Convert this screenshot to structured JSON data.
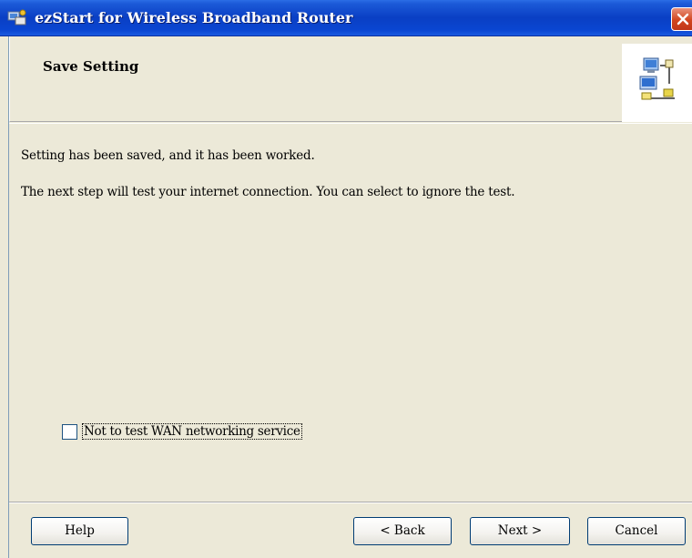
{
  "window": {
    "title": "ezStart for Wireless Broadband Router"
  },
  "header": {
    "title": "Save Setting",
    "logo_icon": "network-computers-icon"
  },
  "content": {
    "line1": "Setting has been saved, and it has been worked.",
    "line2": "The next step will test your internet connection. You can select to ignore the test."
  },
  "options": {
    "skip_test_label": "Not to test WAN networking service",
    "skip_test_checked": false
  },
  "buttons": {
    "help": "Help",
    "back": "< Back",
    "next": "Next >",
    "cancel": "Cancel"
  },
  "colors": {
    "titlebar": "#0a3fc4",
    "close_button": "#d2451e",
    "background": "#ece9d8"
  }
}
